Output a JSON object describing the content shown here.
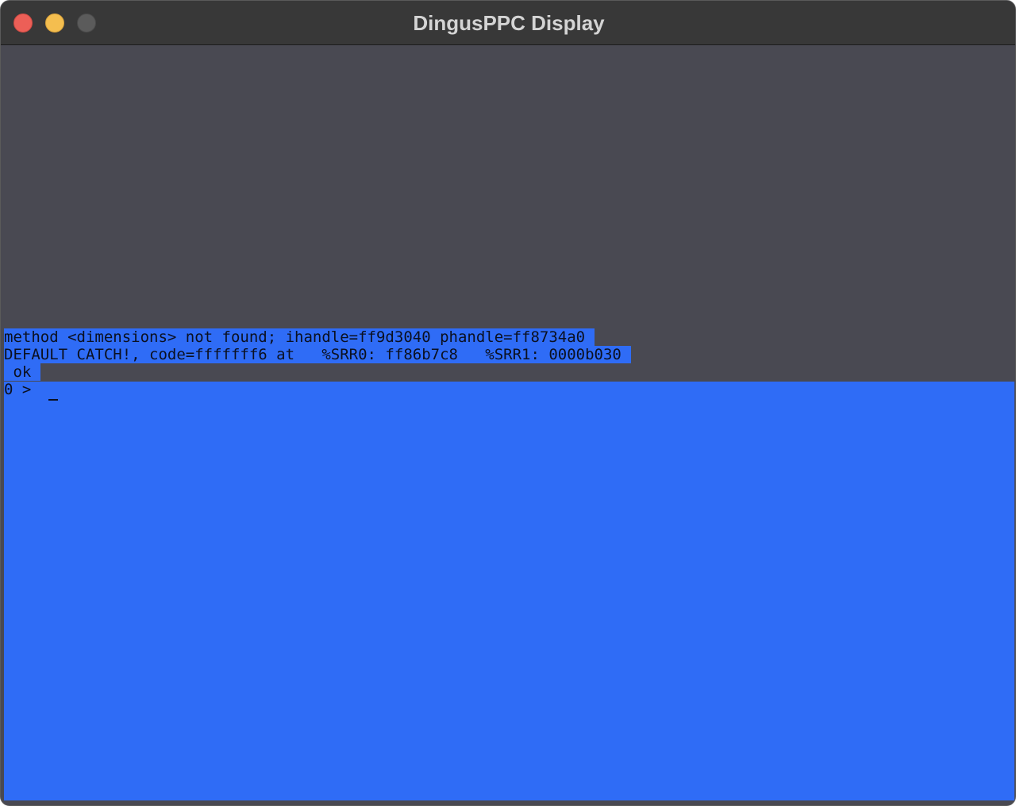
{
  "window": {
    "title": "DingusPPC Display"
  },
  "console": {
    "lines": [
      "method <dimensions> not found; ihandle=ff9d3040 phandle=ff8734a0",
      "DEFAULT CATCH!, code=fffffff6 at   %SRR0: ff86b7c8   %SRR1: 0000b030",
      " ok",
      "0 > "
    ]
  },
  "colors": {
    "titlebar": "#383838",
    "background": "#494952",
    "selection_blue": "#2f6cf6",
    "close": "#ec5f57",
    "minimize": "#f4be4f",
    "zoom": "#5b5b5b"
  }
}
